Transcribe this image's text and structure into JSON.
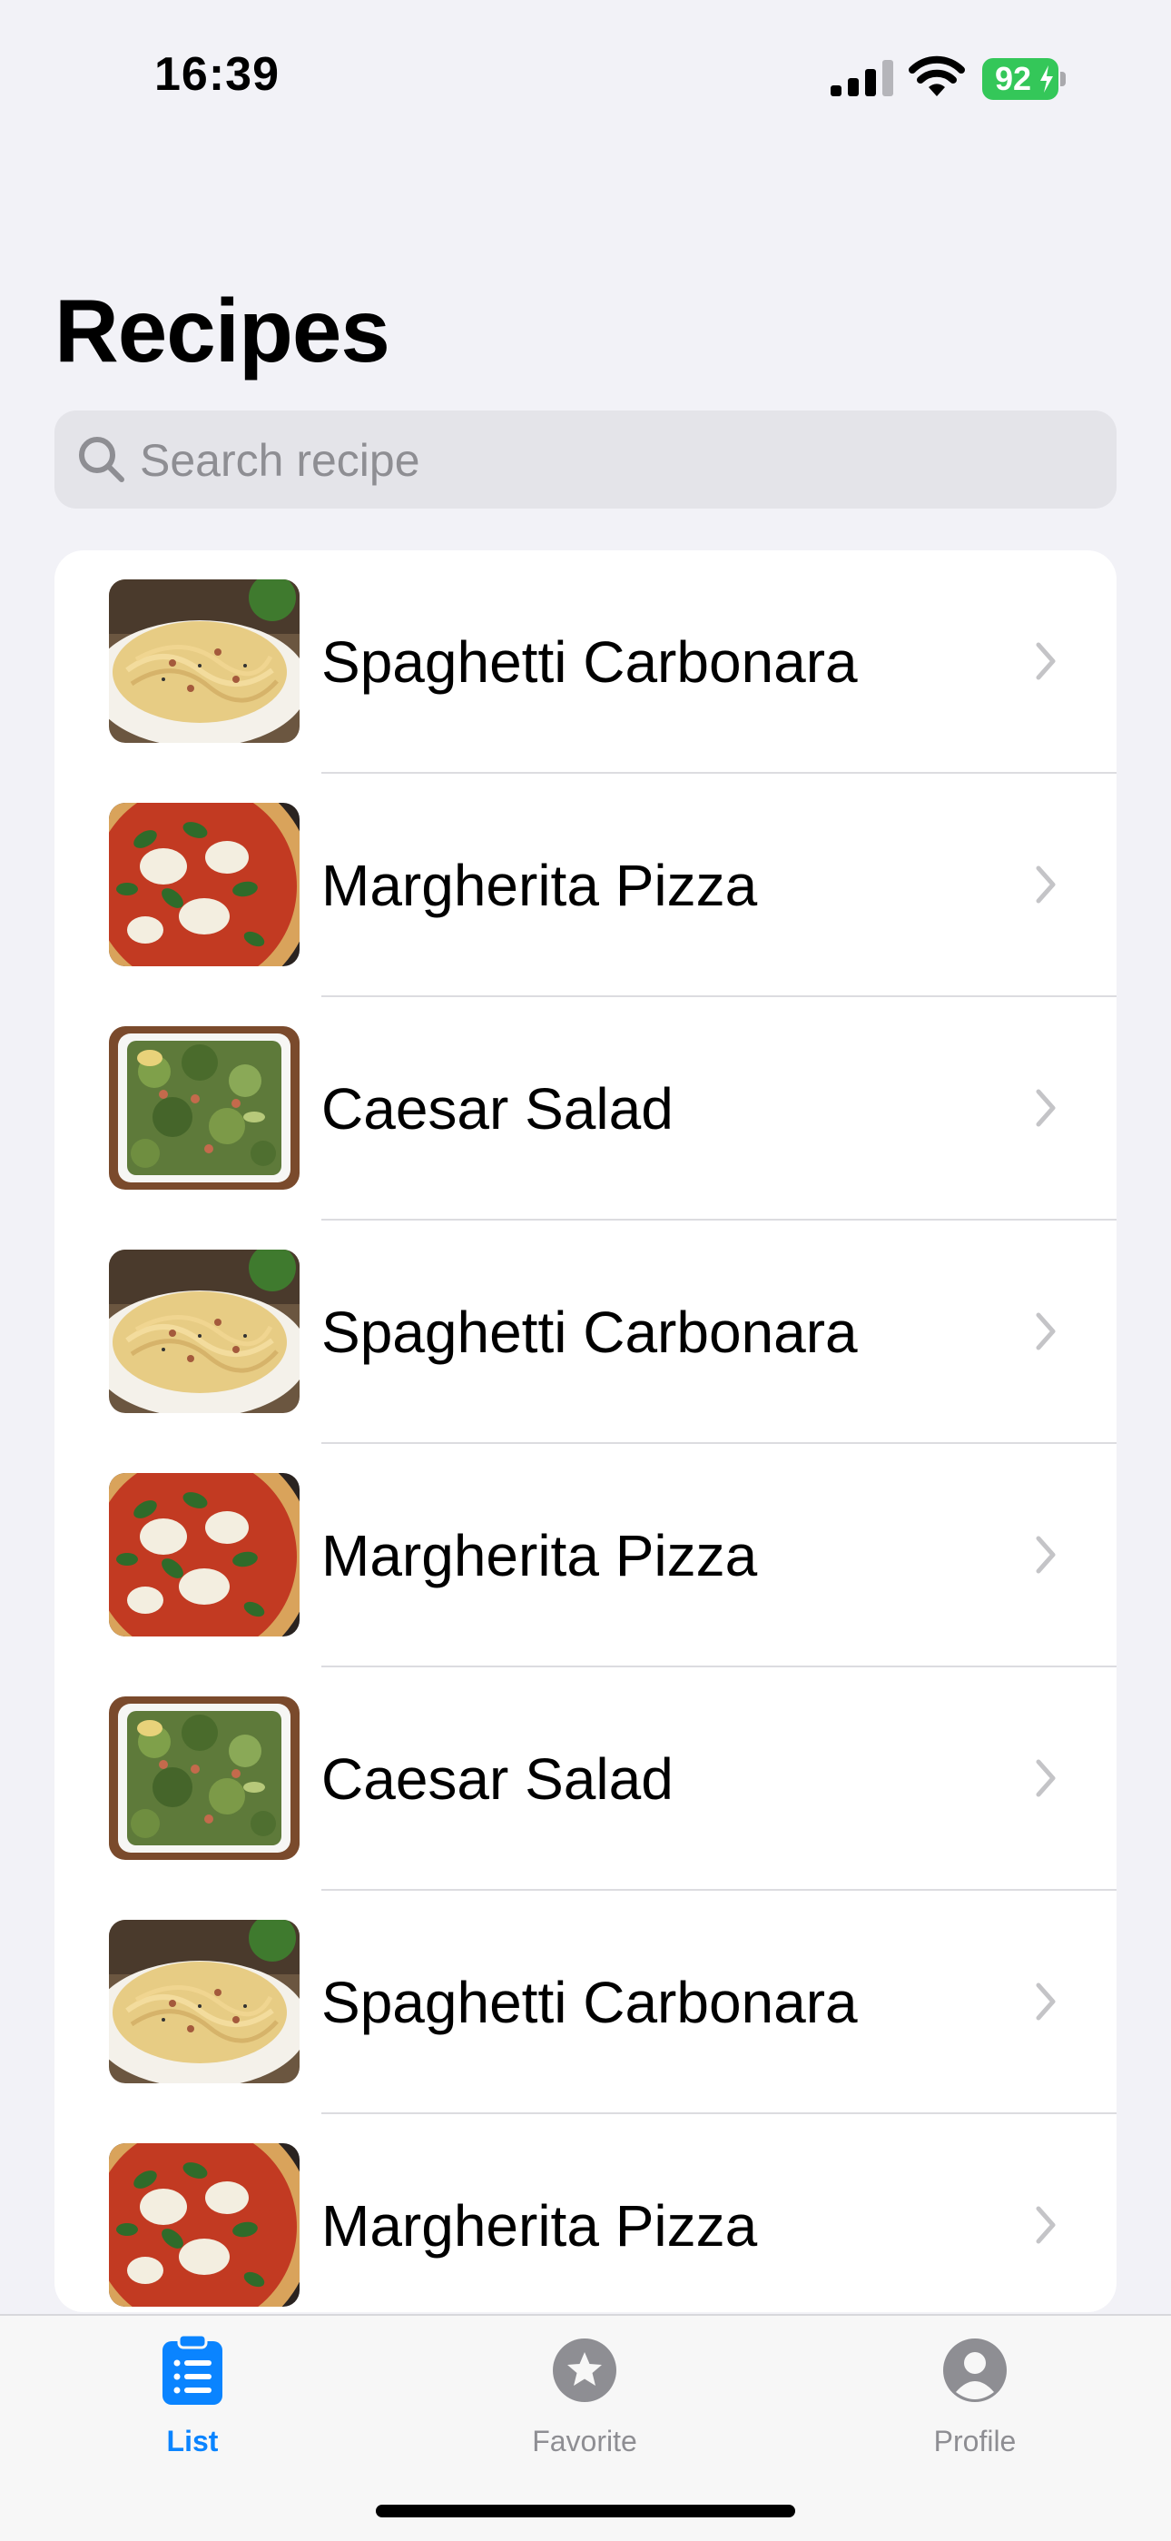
{
  "status": {
    "time": "16:39",
    "battery": "92"
  },
  "header": {
    "title": "Recipes"
  },
  "search": {
    "placeholder": "Search recipe"
  },
  "recipes": [
    {
      "name": "Spaghetti Carbonara",
      "image": "carbonara"
    },
    {
      "name": "Margherita Pizza",
      "image": "pizza"
    },
    {
      "name": "Caesar Salad",
      "image": "salad"
    },
    {
      "name": "Spaghetti Carbonara",
      "image": "carbonara"
    },
    {
      "name": "Margherita Pizza",
      "image": "pizza"
    },
    {
      "name": "Caesar Salad",
      "image": "salad"
    },
    {
      "name": "Spaghetti Carbonara",
      "image": "carbonara"
    },
    {
      "name": "Margherita Pizza",
      "image": "pizza"
    }
  ],
  "tabs": [
    {
      "label": "List",
      "icon": "clipboard-list-icon",
      "active": true
    },
    {
      "label": "Favorite",
      "icon": "star-circle-icon",
      "active": false
    },
    {
      "label": "Profile",
      "icon": "person-circle-icon",
      "active": false
    }
  ],
  "colors": {
    "accent": "#0a84ff",
    "background": "#f2f2f7",
    "battery": "#34c759"
  }
}
